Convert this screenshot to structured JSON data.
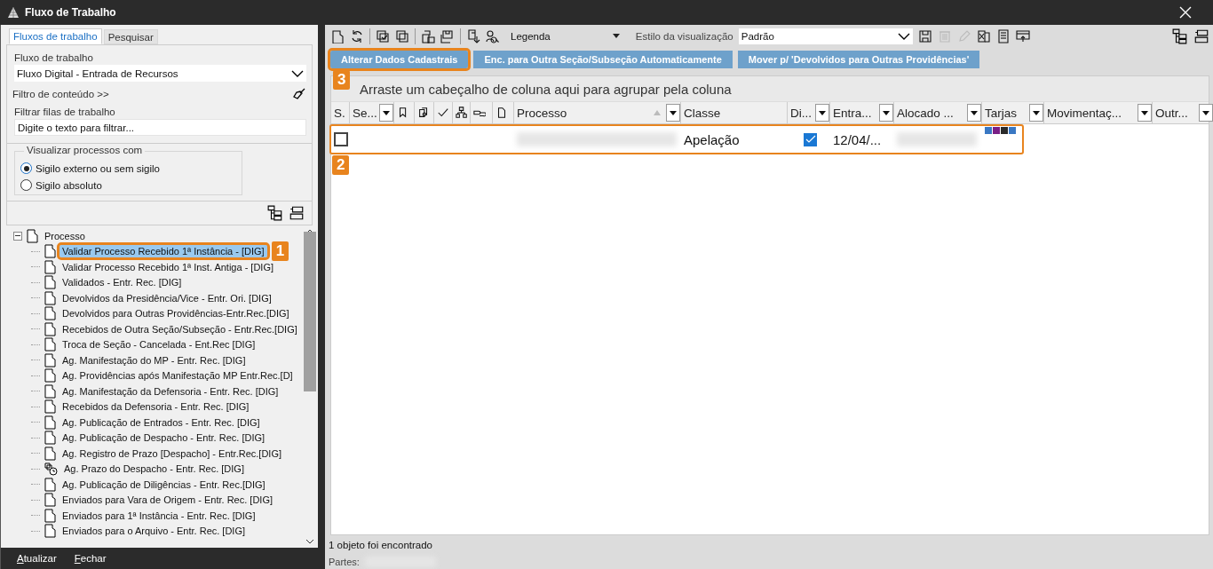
{
  "window": {
    "title": "Fluxo de Trabalho"
  },
  "left_tabs": [
    {
      "label": "Fluxos de trabalho",
      "selected": true
    },
    {
      "label": "Pesquisar",
      "selected": false
    }
  ],
  "workflow": {
    "label": "Fluxo de trabalho",
    "value": "Fluxo Digital - Entrada de Recursos"
  },
  "content_filter": {
    "label": "Filtro de conteúdo >>"
  },
  "queue_filter": {
    "label": "Filtrar filas de trabalho",
    "value": "Digite o texto para filtrar..."
  },
  "visibility": {
    "legend": "Visualizar processos com",
    "options": [
      {
        "label": "Sigilo externo ou sem sigilo",
        "selected": true
      },
      {
        "label": "Sigilo absoluto",
        "selected": false
      }
    ]
  },
  "tree": {
    "label": "Processo",
    "expanded": true,
    "children": [
      {
        "label": "Validar Processo Recebido 1ª Instância - [DIG]",
        "kind": "queue",
        "selected": true,
        "callout": "1"
      },
      {
        "label": "Validar Processo Recebido 1ª Inst. Antiga - [DIG]",
        "kind": "queue",
        "selected": false
      },
      {
        "label": "Validados - Entr. Rec. [DIG]",
        "kind": "queue",
        "selected": false
      },
      {
        "label": "Devolvidos da Presidência/Vice - Entr. Ori. [DIG]",
        "kind": "queue",
        "selected": false
      },
      {
        "label": "Devolvidos para Outras Providências-Entr.Rec.[DIG]",
        "kind": "queue",
        "selected": false
      },
      {
        "label": "Recebidos de Outra Seção/Subseção - Entr.Rec.[DIG]",
        "kind": "queue",
        "selected": false
      },
      {
        "label": "Troca de Seção - Cancelada - Ent.Rec [DIG]",
        "kind": "queue",
        "selected": false
      },
      {
        "label": "Ag. Manifestação do MP - Entr. Rec. [DIG]",
        "kind": "queue",
        "selected": false
      },
      {
        "label": "Ag. Providências após Manifestação MP Entr.Rec.[D]",
        "kind": "queue",
        "selected": false
      },
      {
        "label": "Ag. Manifestação da Defensoria - Entr. Rec. [DIG]",
        "kind": "queue",
        "selected": false
      },
      {
        "label": "Recebidos da Defensoria - Entr. Rec. [DIG]",
        "kind": "queue",
        "selected": false
      },
      {
        "label": "Ag. Publicação de Entrados - Entr. Rec. [DIG]",
        "kind": "queue",
        "selected": false
      },
      {
        "label": "Ag. Publicação de Despacho - Entr. Rec. [DIG]",
        "kind": "queue",
        "selected": false
      },
      {
        "label": "Ag. Registro de Prazo [Despacho] - Entr.Rec.[DIG]",
        "kind": "queue",
        "selected": false
      },
      {
        "label": "Ag. Prazo do Despacho - Entr. Rec. [DIG]",
        "kind": "timer",
        "selected": false
      },
      {
        "label": "Ag. Publicação de Diligências - Entr. Rec.[DIG]",
        "kind": "queue",
        "selected": false
      },
      {
        "label": "Enviados para Vara de Origem - Entr. Rec. [DIG]",
        "kind": "queue",
        "selected": false
      },
      {
        "label": "Enviados para 1ª Instância - Entr. Rec. [DIG]",
        "kind": "queue",
        "selected": false
      },
      {
        "label": "Enviados para o Arquivo - Entr. Rec. [DIG]",
        "kind": "queue",
        "selected": false
      }
    ]
  },
  "footer_buttons": [
    {
      "label": "Atualizar"
    },
    {
      "label": "Fechar"
    }
  ],
  "toolbar": {
    "legend": {
      "value": "Legenda"
    },
    "view_style": {
      "label": "Estilo da visualização",
      "value": "Padrão"
    }
  },
  "actions": [
    {
      "label": "Alterar Dados Cadastrais",
      "callout": "3"
    },
    {
      "label": "Enc. para Outra Seção/Subseção Automaticamente"
    },
    {
      "label": "Mover p/ 'Devolvidos para Outras Providências'"
    }
  ],
  "grid": {
    "group_hint": "Arraste um cabeçalho de coluna aqui para agrupar pela coluna",
    "columns": [
      {
        "kind": "text",
        "label": "S.",
        "filter": false,
        "sorted": false
      },
      {
        "kind": "text",
        "label": "Se...",
        "filter": true,
        "sorted": false
      },
      {
        "kind": "icon",
        "filter": false,
        "sorted": false
      },
      {
        "kind": "icon",
        "filter": false,
        "sorted": false
      },
      {
        "kind": "icon",
        "filter": false,
        "sorted": false
      },
      {
        "kind": "icon",
        "filter": false,
        "sorted": false
      },
      {
        "kind": "icon",
        "filter": false,
        "sorted": false
      },
      {
        "kind": "icon",
        "filter": false,
        "sorted": false
      },
      {
        "kind": "text",
        "label": "Processo",
        "filter": true,
        "sorted": true
      },
      {
        "kind": "text",
        "label": "Classe",
        "filter": false,
        "sorted": false
      },
      {
        "kind": "text",
        "label": "Di...",
        "filter": true,
        "sorted": false
      },
      {
        "kind": "text",
        "label": "Entra...",
        "filter": true,
        "sorted": false
      },
      {
        "kind": "text",
        "label": "Alocado ...",
        "filter": true,
        "sorted": false
      },
      {
        "kind": "text",
        "label": "Tarjas",
        "filter": true,
        "sorted": false
      },
      {
        "kind": "text",
        "label": "Movimentaç...",
        "filter": true,
        "sorted": false
      },
      {
        "kind": "text",
        "label": "Outr...",
        "filter": true,
        "sorted": false
      }
    ],
    "rows": [
      {
        "checked": false,
        "classe": "Apelação",
        "digital": true,
        "entrada": "12/04/...",
        "callout": "2",
        "tarjas": [
          {
            "color": "#3a78c3"
          },
          {
            "color": "#7a1f86"
          },
          {
            "color": "#2a2a2a"
          },
          {
            "color": "#3a78c3"
          }
        ]
      }
    ]
  },
  "status": {
    "count": "1 objeto foi encontrado",
    "parts_label": "Partes:"
  }
}
